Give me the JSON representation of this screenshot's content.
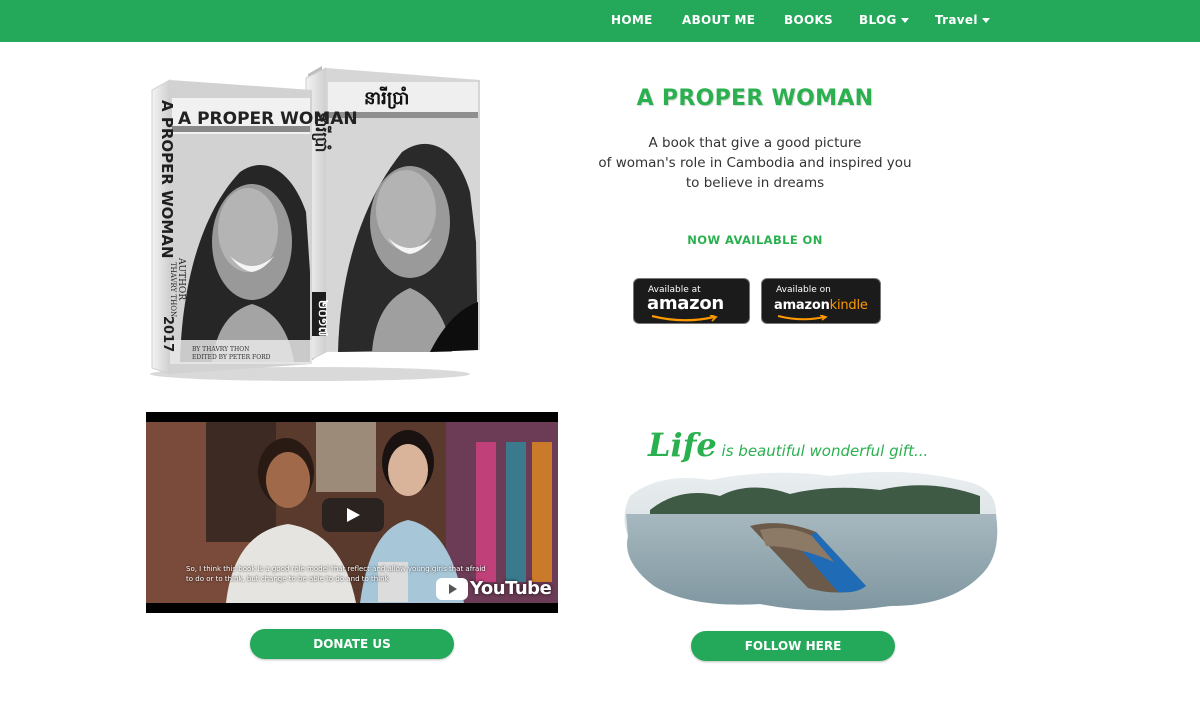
{
  "nav": {
    "items": [
      {
        "label": "HOME"
      },
      {
        "label": "ABOUT ME"
      },
      {
        "label": "BOOKS"
      },
      {
        "label": "BLOG"
      },
      {
        "label": "Travel"
      }
    ]
  },
  "books_image": {
    "book1": {
      "cover_title": "A PROPER WOMAN",
      "spine_text": "A PROPER WOMAN",
      "spine_author_label": "AUTHOR",
      "spine_author": "THAVRY THON",
      "spine_year": "2017",
      "author_line": "BY THAVRY THON",
      "editor_line": "EDITED BY PETER FORD"
    },
    "book2": {
      "cover_title": "នារីប្រាំ",
      "spine_text": "នារីប្រាំ",
      "spine_year": "២០១៧"
    }
  },
  "hero": {
    "title": "A PROPER WOMAN",
    "desc_lines": [
      "A book that give a good picture",
      "of woman's role in Cambodia and inspired you",
      "to believe in dreams"
    ],
    "available_label": "NOW AVAILABLE ON",
    "amazon": {
      "small": "Available at",
      "big": "amazon"
    },
    "kindle": {
      "small": "Available on",
      "brand": "amazon",
      "kindle": "kindle"
    }
  },
  "video": {
    "caption": "So, I think this book is a good role model that reflect and allow young girls that afraid to do or to think, but change to be able to do and to think",
    "youtube": "YouTube"
  },
  "life": {
    "big": "Life",
    "rest": " is beautiful wonderful gift..."
  },
  "buttons": {
    "donate": "DONATE US",
    "follow": "FOLLOW HERE"
  },
  "colors": {
    "brand_green": "#24a85a",
    "title_green": "#2bb04f"
  },
  "icons": [
    "chevron-down-icon",
    "play-icon",
    "youtube-icon",
    "amazon-smile-icon"
  ]
}
